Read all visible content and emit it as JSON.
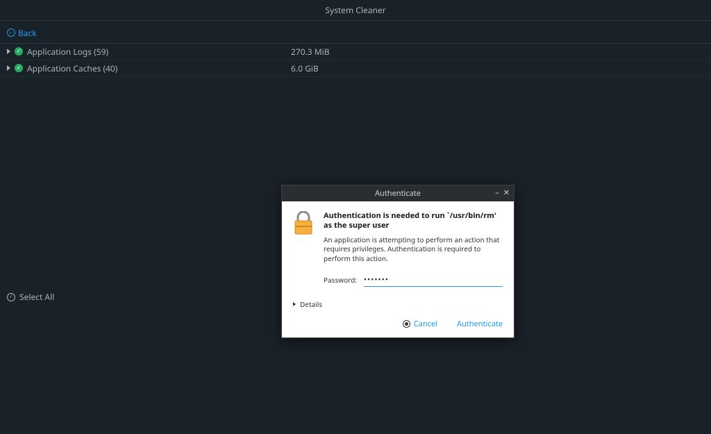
{
  "header": {
    "title": "System Cleaner"
  },
  "toolbar": {
    "back_label": "Back"
  },
  "list": [
    {
      "label": "Application Logs (59)",
      "size": "270.3 MiB"
    },
    {
      "label": "Application Caches (40)",
      "size": "6.0 GiB"
    }
  ],
  "select_all_label": "Select All",
  "dialog": {
    "title": "Authenticate",
    "heading": "Authentication is needed to run `/usr/bin/rm' as the super user",
    "body": "An application is attempting to perform an action that requires privileges. Authentication is required to perform this action.",
    "password_label": "Password:",
    "password_value": "•••••••",
    "details_label": "Details",
    "cancel_label": "Cancel",
    "authenticate_label": "Authenticate"
  }
}
